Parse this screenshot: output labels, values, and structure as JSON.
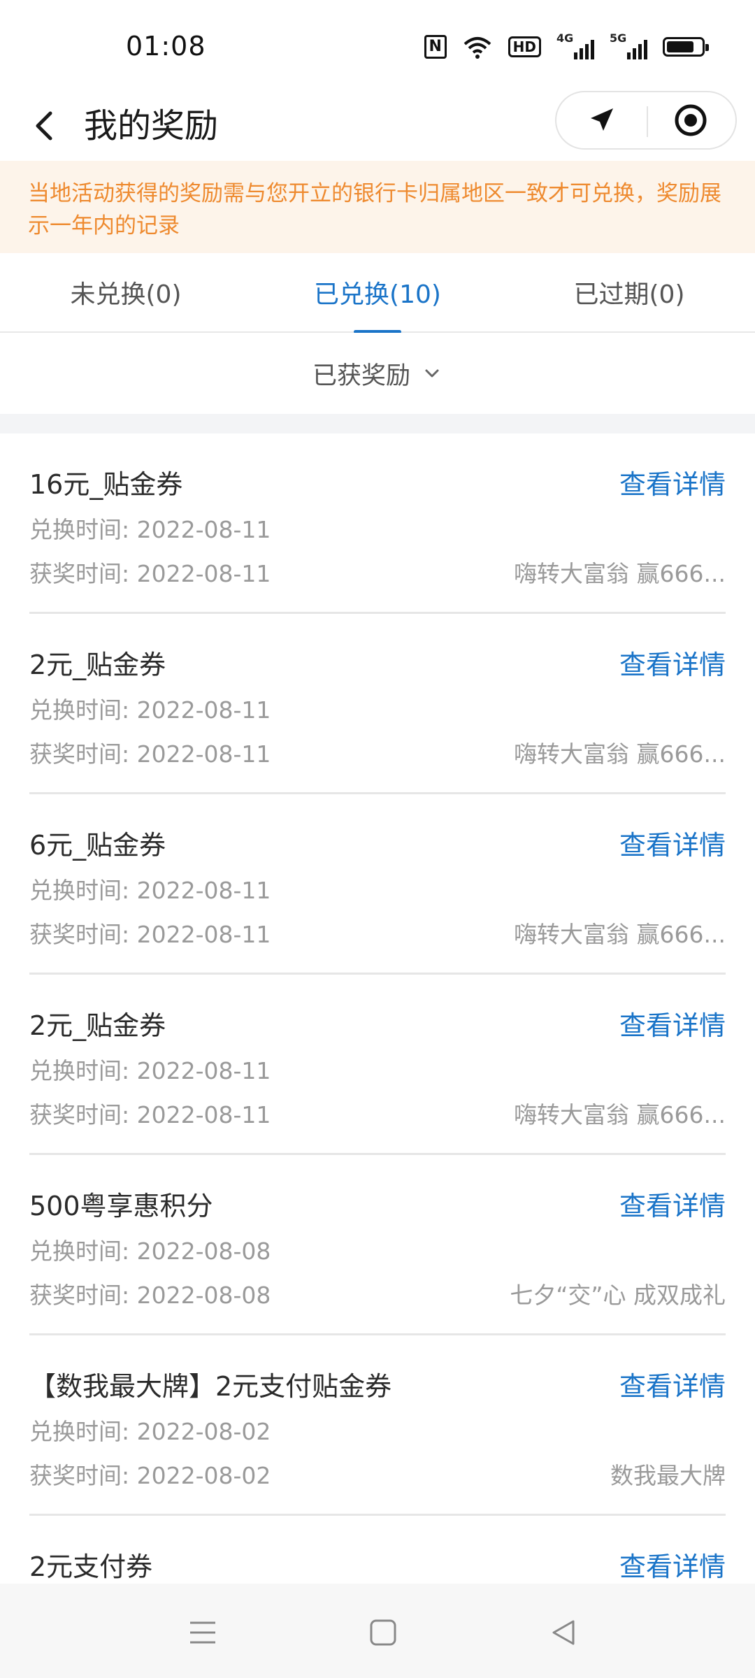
{
  "status_bar": {
    "time": "01:08",
    "icons": [
      "nfc-icon",
      "wifi-icon",
      "hd-icon",
      "signal-4g-icon",
      "signal-5g-icon",
      "battery-icon"
    ],
    "nfc": "N",
    "hd": "HD",
    "net1": "4G",
    "net2": "5G"
  },
  "header": {
    "title": "我的奖励",
    "back_icon": "chevron-left-icon",
    "capsule": [
      "navigation-arrow-icon",
      "record-target-icon"
    ]
  },
  "notice": {
    "text": "当地活动获得的奖励需与您开立的银行卡归属地区一致才可兑换，奖励展示一年内的记录"
  },
  "tabs": [
    {
      "label": "未兑换(0)",
      "active": false
    },
    {
      "label": "已兑换(10)",
      "active": true
    },
    {
      "label": "已过期(0)",
      "active": false
    }
  ],
  "filter": {
    "label": "已获奖励",
    "icon": "chevron-down-icon"
  },
  "items": [
    {
      "title": "16元_贴金券",
      "detail": "查看详情",
      "exchange": "兑换时间: 2022-08-11",
      "award": "获奖时间: 2022-08-11",
      "source": "嗨转大富翁 赢666..."
    },
    {
      "title": "2元_贴金券",
      "detail": "查看详情",
      "exchange": "兑换时间: 2022-08-11",
      "award": "获奖时间: 2022-08-11",
      "source": "嗨转大富翁 赢666..."
    },
    {
      "title": "6元_贴金券",
      "detail": "查看详情",
      "exchange": "兑换时间: 2022-08-11",
      "award": "获奖时间: 2022-08-11",
      "source": "嗨转大富翁 赢666..."
    },
    {
      "title": "2元_贴金券",
      "detail": "查看详情",
      "exchange": "兑换时间: 2022-08-11",
      "award": "获奖时间: 2022-08-11",
      "source": "嗨转大富翁 赢666..."
    },
    {
      "title": "500粤享惠积分",
      "detail": "查看详情",
      "exchange": "兑换时间: 2022-08-08",
      "award": "获奖时间: 2022-08-08",
      "source": "七夕“交”心 成双成礼"
    },
    {
      "title": "【数我最大牌】2元支付贴金券",
      "detail": "查看详情",
      "exchange": "兑换时间: 2022-08-02",
      "award": "获奖时间: 2022-08-02",
      "source": "数我最大牌"
    },
    {
      "title": "2元支付券",
      "detail": "查看详情",
      "exchange": "",
      "award": "",
      "source": ""
    }
  ],
  "nav_bar": [
    "menu-icon",
    "home-square-icon",
    "back-triangle-icon"
  ],
  "colors": {
    "accent": "#1a74c8",
    "notice_text": "#ee8a2f",
    "notice_bg": "#fdf4ea"
  }
}
